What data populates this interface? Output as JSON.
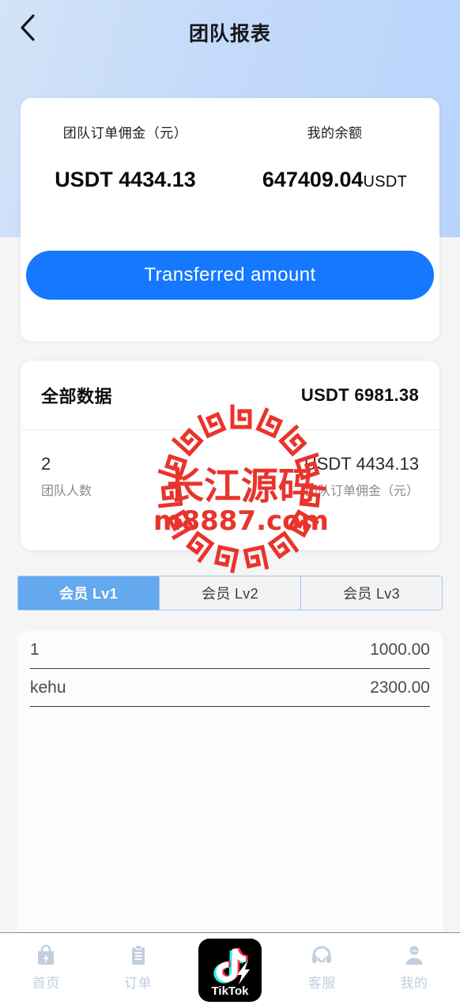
{
  "header": {
    "title": "团队报表",
    "back_icon": "chevron-left-icon"
  },
  "summary": {
    "commission_label": "团队订单佣金（元）",
    "commission_value": "USDT 4434.13",
    "balance_label": "我的余额",
    "balance_value": "647409.04",
    "balance_unit": "USDT",
    "transfer_button": "Transferred amount"
  },
  "all_data": {
    "title": "全部数据",
    "total": "USDT 6981.38",
    "stats": [
      {
        "value": "2",
        "label": "团队人数"
      },
      {
        "value": "USDT 4434.13",
        "label": "团队订单佣金（元）"
      }
    ]
  },
  "tabs": [
    {
      "label": "会员 Lv1",
      "active": true
    },
    {
      "label": "会员 Lv2",
      "active": false
    },
    {
      "label": "会员 Lv3",
      "active": false
    }
  ],
  "member_list": {
    "rows": [
      {
        "name": "1",
        "amount": "1000.00"
      },
      {
        "name": "kehu",
        "amount": "2300.00"
      }
    ]
  },
  "watermark": {
    "title": "长江源码",
    "url": "m8887.com"
  },
  "bottom_nav": [
    {
      "label": "首页",
      "icon": "shopping-bag-icon"
    },
    {
      "label": "订单",
      "icon": "clipboard-icon"
    },
    {
      "label": "TikTok",
      "icon": "tiktok-logo-icon"
    },
    {
      "label": "客服",
      "icon": "headset-icon"
    },
    {
      "label": "我的",
      "icon": "person-icon"
    }
  ],
  "colors": {
    "accent_blue": "#1677ff",
    "tab_active": "#64a8ee",
    "header_gradient_start": "#d3e3f8",
    "header_gradient_end": "#b9d4fb",
    "nav_icon": "#c2cee0",
    "watermark_red": "#e8342c"
  }
}
